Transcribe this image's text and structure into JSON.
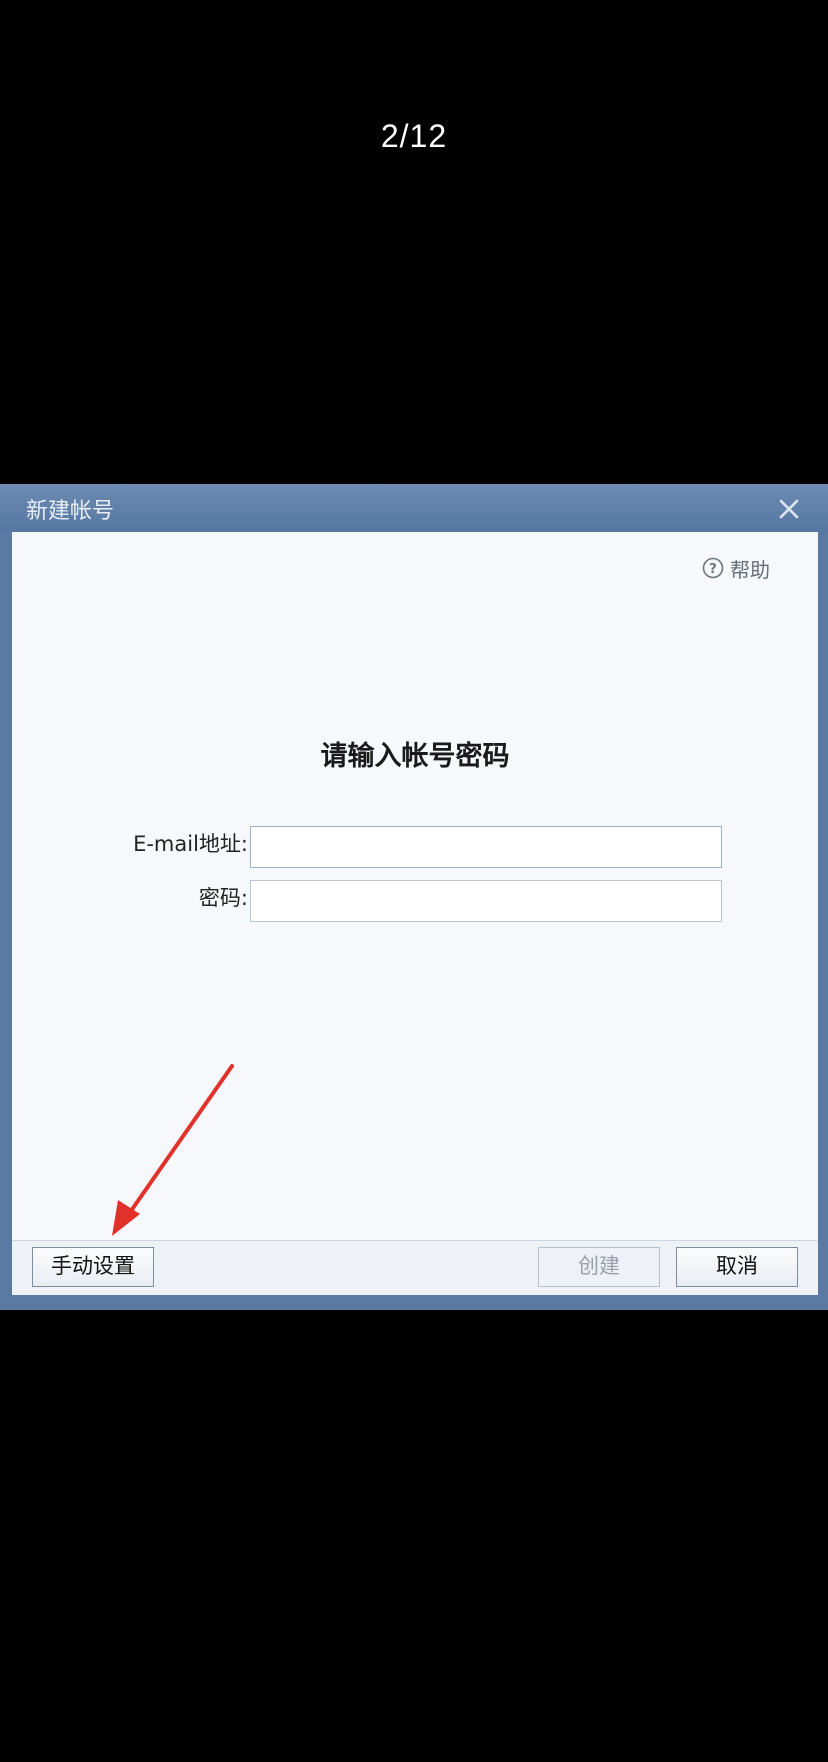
{
  "page_counter": "2/12",
  "dialog": {
    "title": "新建帐号",
    "help_label": "帮助",
    "heading": "请输入帐号密码",
    "email_label": "E-mail地址:",
    "email_value": "",
    "password_label": "密码:",
    "password_value": "",
    "buttons": {
      "manual": "手动设置",
      "create": "创建",
      "cancel": "取消"
    }
  },
  "annotation": {
    "arrow_color": "#e0322b"
  },
  "colors": {
    "titlebar": "#5b7aa3",
    "client_bg": "#f6f8fc",
    "background": "#000000"
  },
  "icons": {
    "close": "close-icon",
    "help": "question-circle-icon"
  }
}
